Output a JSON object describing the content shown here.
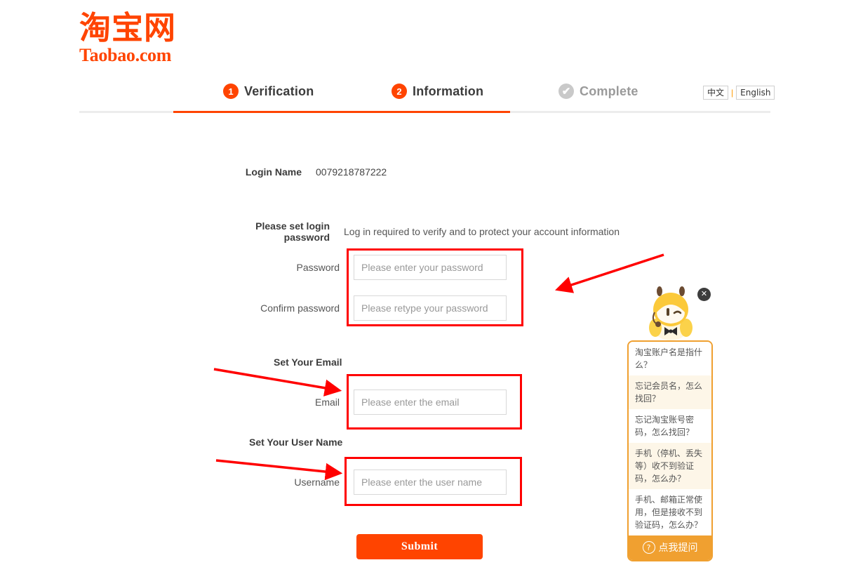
{
  "logo": {
    "cn": "淘宝网",
    "en": "Taobao.com",
    "color": "#ff4400"
  },
  "steps": [
    {
      "num": "1",
      "label": "Verification",
      "state": "active"
    },
    {
      "num": "2",
      "label": "Information",
      "state": "active"
    },
    {
      "num": "✔",
      "label": "Complete",
      "state": "pending"
    }
  ],
  "language": {
    "chinese": "中文",
    "separator": "|",
    "english": "English"
  },
  "form": {
    "login_name_label": "Login Name",
    "login_name_value": "0079218787222",
    "set_password_label": "Please set login password",
    "set_password_hint": "Log in required to verify and to protect your account information",
    "password_label": "Password",
    "password_placeholder": "Please enter your password",
    "password_value": "",
    "confirm_label": "Confirm password",
    "confirm_placeholder": "Please retype your password",
    "confirm_value": "",
    "email_section": "Set Your Email",
    "email_label": "Email",
    "email_placeholder": "Please enter the email",
    "email_value": "",
    "username_section": "Set Your User Name",
    "username_label": "Username",
    "username_placeholder": "Please enter the user name",
    "username_value": "",
    "submit_label": "Submit"
  },
  "chat": {
    "close_label": "✕",
    "items": [
      "淘宝账户名是指什么？",
      "忘记会员名，怎么找回？",
      "忘记淘宝账号密码，怎么找回？",
      "手机（停机、丢失等）收不到验证码，怎么办？",
      "手机、邮箱正常使用，但是接收不到验证码，怎么办？"
    ],
    "ask_label": "点我提问",
    "ask_icon": "?"
  },
  "annotations": {
    "box_count": 3,
    "arrow_count": 3,
    "color": "#ff0000"
  }
}
